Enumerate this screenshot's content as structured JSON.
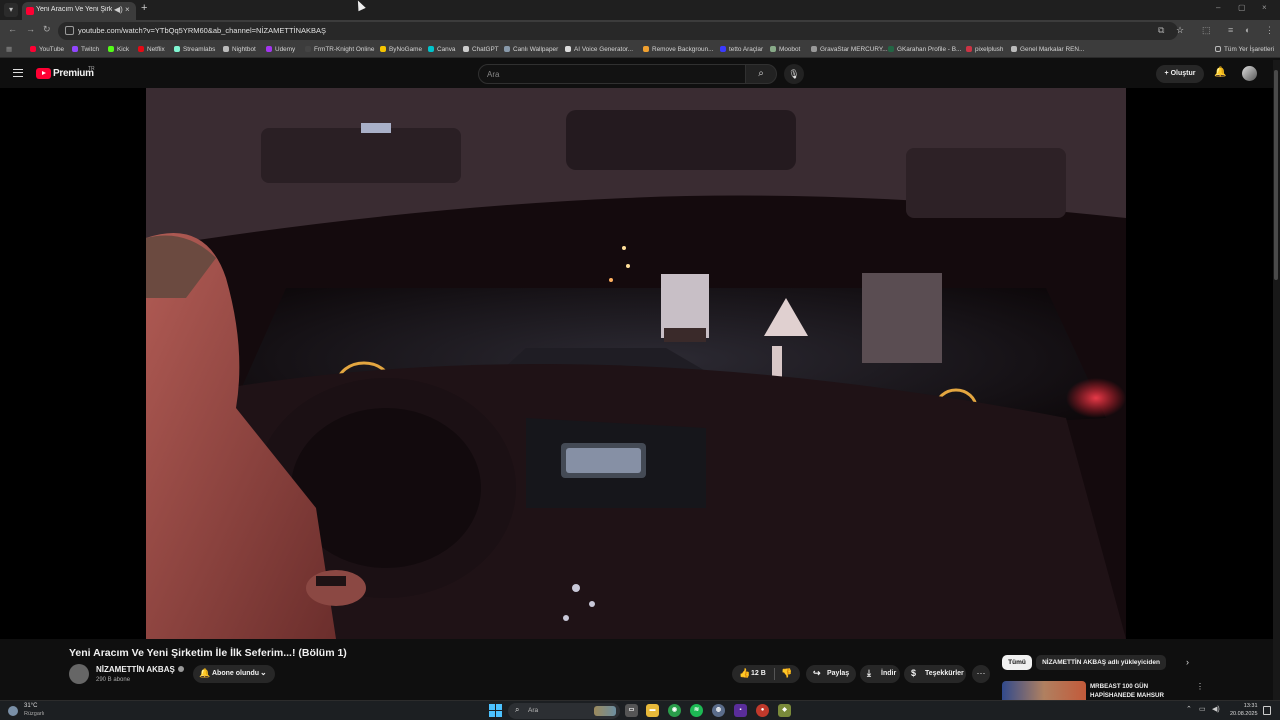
{
  "browser": {
    "tab": {
      "title": "Yeni Aracım Ve Yeni Şirketim",
      "audio_icon": "speaker-icon",
      "close": "×"
    },
    "new_tab": "+",
    "window_controls": [
      "–",
      "▢",
      "×"
    ],
    "url": "youtube.com/watch?v=YTbQq5YRM60&ab_channel=NİZAMETTİNAKBAŞ",
    "nav": {
      "back": "←",
      "forward": "→",
      "reload": "↻"
    },
    "bookmarks": [
      {
        "label": "YouTube",
        "color": "#ff0033"
      },
      {
        "label": "Twitch",
        "color": "#9146ff"
      },
      {
        "label": "Kick",
        "color": "#53fc18"
      },
      {
        "label": "Netflix",
        "color": "#e50914"
      },
      {
        "label": "Streamlabs",
        "color": "#80f5d2"
      },
      {
        "label": "Nightbot",
        "color": "#bbbbbb"
      },
      {
        "label": "Udemy",
        "color": "#a435f0"
      },
      {
        "label": "FrmTR-Knight Online",
        "color": "#444444"
      },
      {
        "label": "ByNoGame",
        "color": "#f5c400"
      },
      {
        "label": "Canva",
        "color": "#00c4cc"
      },
      {
        "label": "ChatGPT",
        "color": "#cccccc"
      },
      {
        "label": "Canlı Wallpaper",
        "color": "#8899aa"
      },
      {
        "label": "AI Voice Generator...",
        "color": "#dddddd"
      },
      {
        "label": "Remove Backgroun...",
        "color": "#f0a030"
      },
      {
        "label": "tetto Araçlar",
        "color": "#3a3aff"
      },
      {
        "label": "Moobot",
        "color": "#88aa88"
      },
      {
        "label": "GravaStar MERCURY...",
        "color": "#999999"
      },
      {
        "label": "GKarahan Profile - B...",
        "color": "#226644"
      },
      {
        "label": "pixelplush",
        "color": "#cc3344"
      },
      {
        "label": "Genel Markalar REN...",
        "color": "#bbbbbb"
      }
    ],
    "all_bookmarks": "Tüm Yer İşaretleri"
  },
  "youtube": {
    "logo_text": "Premium",
    "region": "TR",
    "search_placeholder": "Ara",
    "create_label": "Oluştur",
    "video_title": "Yeni Aracım Ve Yeni Şirketim İle İlk Seferim...! (Bölüm 1)",
    "channel_name": "NİZAMETTİN AKBAŞ",
    "subscribers": "290 B abone",
    "subscribe_label": "Abone olundu",
    "like_count": "12 B",
    "share_label": "Paylaş",
    "download_label": "İndir",
    "thanks_label": "Teşekkürler",
    "chips": [
      "Tümü",
      "NİZAMETTİN AKBAŞ adlı yükleyiciden"
    ],
    "rec_title": "MRBEAST 100 GÜN HAPİSHANEDE MAHSUR"
  },
  "taskbar": {
    "weather_temp": "31°C",
    "weather_desc": "Rüzgarlı",
    "search_label": "Ara",
    "time": "13:31",
    "date": "20.08.2025"
  }
}
